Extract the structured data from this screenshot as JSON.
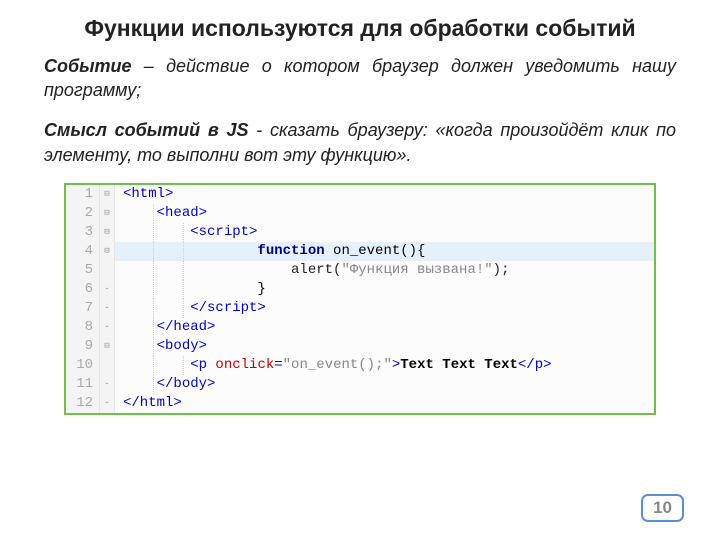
{
  "title": "Функции используются для обработки событий",
  "para1": {
    "lead": "Событие",
    "rest": " – действие о котором браузер должен уведомить нашу программу;"
  },
  "para2": {
    "lead": "Смысл событий в JS",
    "rest": " - сказать браузеру: «когда произойдёт клик по элементу, то выполни вот эту функцию»."
  },
  "code": {
    "lines": [
      {
        "n": "1",
        "mark": "⊟",
        "frags": [
          {
            "c": "tag",
            "t": "<html>"
          }
        ],
        "g": []
      },
      {
        "n": "2",
        "mark": "⊟",
        "frags": [
          {
            "c": "",
            "t": "    "
          },
          {
            "c": "tag",
            "t": "<head>"
          }
        ],
        "g": [
          "g1"
        ]
      },
      {
        "n": "3",
        "mark": "⊟",
        "frags": [
          {
            "c": "",
            "t": "        "
          },
          {
            "c": "tag",
            "t": "<script>"
          }
        ],
        "g": [
          "g1",
          "g2"
        ]
      },
      {
        "n": "4",
        "mark": "⊟",
        "hl": true,
        "frags": [
          {
            "c": "",
            "t": "                "
          },
          {
            "c": "kw",
            "t": "function"
          },
          {
            "c": "fn",
            "t": " on_event(){"
          }
        ],
        "g": [
          "g1",
          "g2"
        ]
      },
      {
        "n": "5",
        "mark": "",
        "frags": [
          {
            "c": "",
            "t": "                    alert("
          },
          {
            "c": "str",
            "t": "\"Функция вызвана!\""
          },
          {
            "c": "",
            "t": ");"
          }
        ],
        "g": [
          "g1",
          "g2"
        ]
      },
      {
        "n": "6",
        "mark": "-",
        "frags": [
          {
            "c": "",
            "t": "                "
          },
          {
            "c": "fn",
            "t": "}"
          }
        ],
        "g": [
          "g1",
          "g2"
        ]
      },
      {
        "n": "7",
        "mark": "-",
        "frags": [
          {
            "c": "",
            "t": "        "
          },
          {
            "c": "tag",
            "t": "</script​>"
          }
        ],
        "g": [
          "g1",
          "g2"
        ]
      },
      {
        "n": "8",
        "mark": "-",
        "frags": [
          {
            "c": "",
            "t": "    "
          },
          {
            "c": "tag",
            "t": "</head>"
          }
        ],
        "g": [
          "g1"
        ]
      },
      {
        "n": "9",
        "mark": "⊟",
        "frags": [
          {
            "c": "",
            "t": "    "
          },
          {
            "c": "tag",
            "t": "<body>"
          }
        ],
        "g": [
          "g1"
        ]
      },
      {
        "n": "10",
        "mark": "",
        "frags": [
          {
            "c": "",
            "t": "        "
          },
          {
            "c": "tag",
            "t": "<p"
          },
          {
            "c": "attr",
            "t": " onclick"
          },
          {
            "c": "tag",
            "t": "="
          },
          {
            "c": "str",
            "t": "\"on_event();\""
          },
          {
            "c": "tag",
            "t": ">"
          },
          {
            "c": "txt",
            "t": "Text Text Text"
          },
          {
            "c": "tag",
            "t": "</p>"
          }
        ],
        "g": [
          "g1",
          "g2"
        ]
      },
      {
        "n": "11",
        "mark": "-",
        "frags": [
          {
            "c": "",
            "t": "    "
          },
          {
            "c": "tag",
            "t": "</body>"
          }
        ],
        "g": [
          "g1"
        ]
      },
      {
        "n": "12",
        "mark": "-",
        "frags": [
          {
            "c": "tag",
            "t": "</html>"
          }
        ],
        "g": []
      }
    ]
  },
  "page_number": "10"
}
